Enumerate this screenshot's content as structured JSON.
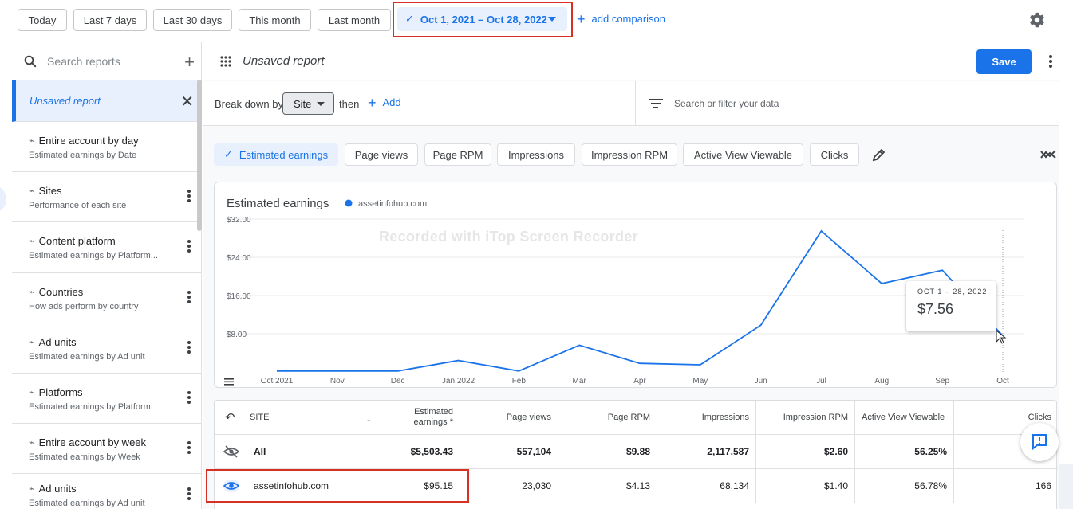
{
  "topbar": {
    "presets": [
      "Today",
      "Last 7 days",
      "Last 30 days",
      "This month",
      "Last month"
    ],
    "date_range": "Oct 1, 2021 – Oct 28, 2022",
    "add_comparison": "add comparison"
  },
  "sidebar": {
    "search_placeholder": "Search reports",
    "unsaved": "Unsaved report",
    "reports": [
      {
        "title": "Entire account by day",
        "subtitle": "Estimated earnings by Date"
      },
      {
        "title": "Sites",
        "subtitle": "Performance of each site"
      },
      {
        "title": "Content platform",
        "subtitle": "Estimated earnings by Platform..."
      },
      {
        "title": "Countries",
        "subtitle": "How ads perform by country"
      },
      {
        "title": "Ad units",
        "subtitle": "Estimated earnings by Ad unit"
      },
      {
        "title": "Platforms",
        "subtitle": "Estimated earnings by Platform"
      },
      {
        "title": "Entire account by week",
        "subtitle": "Estimated earnings by Week"
      },
      {
        "title": "Ad units",
        "subtitle": "Estimated earnings by Ad unit"
      }
    ]
  },
  "header": {
    "title": "Unsaved report",
    "save": "Save"
  },
  "breakdown": {
    "label": "Break down by",
    "selected": "Site",
    "then": "then",
    "add": "Add",
    "filter_placeholder": "Search or filter your data"
  },
  "metrics": [
    "Estimated earnings",
    "Page views",
    "Page RPM",
    "Impressions",
    "Impression RPM",
    "Active View Viewable",
    "Clicks"
  ],
  "watermark": "Recorded with iTop Screen Recorder",
  "chart_data": {
    "type": "line",
    "title": "Estimated earnings",
    "series": [
      {
        "name": "assetinfohub.com",
        "color": "#1a73e8",
        "values": [
          0.2,
          0.2,
          0.2,
          2.4,
          0.2,
          5.6,
          1.8,
          1.5,
          9.8,
          29.5,
          18.5,
          21.3,
          7.56
        ]
      }
    ],
    "x": [
      "Oct 2021",
      "Nov",
      "Dec",
      "Jan 2022",
      "Feb",
      "Mar",
      "Apr",
      "May",
      "Jun",
      "Jul",
      "Aug",
      "Sep",
      "Oct"
    ],
    "yticks": [
      "$32.00",
      "$24.00",
      "$16.00",
      "$8.00"
    ],
    "ytick_values": [
      32,
      24,
      16,
      8
    ],
    "ylim": [
      0,
      36
    ],
    "grid": true,
    "legend": "top-left",
    "tooltip": {
      "label": "OCT 1 – 28, 2022",
      "value": "$7.56"
    }
  },
  "table": {
    "headers": [
      "SITE",
      "Estimated earnings *",
      "Page views",
      "Page RPM",
      "Impressions",
      "Impression RPM",
      "Active View Viewable",
      "Clicks"
    ],
    "rows": [
      {
        "site": "All",
        "earnings": "$5,503.43",
        "page_views": "557,104",
        "page_rpm": "$9.88",
        "impressions": "2,117,587",
        "impression_rpm": "$2.60",
        "active_view": "56.25%",
        "clicks": ""
      },
      {
        "site": "assetinfohub.com",
        "earnings": "$95.15",
        "page_views": "23,030",
        "page_rpm": "$4.13",
        "impressions": "68,134",
        "impression_rpm": "$1.40",
        "active_view": "56.78%",
        "clicks": "166"
      }
    ]
  }
}
